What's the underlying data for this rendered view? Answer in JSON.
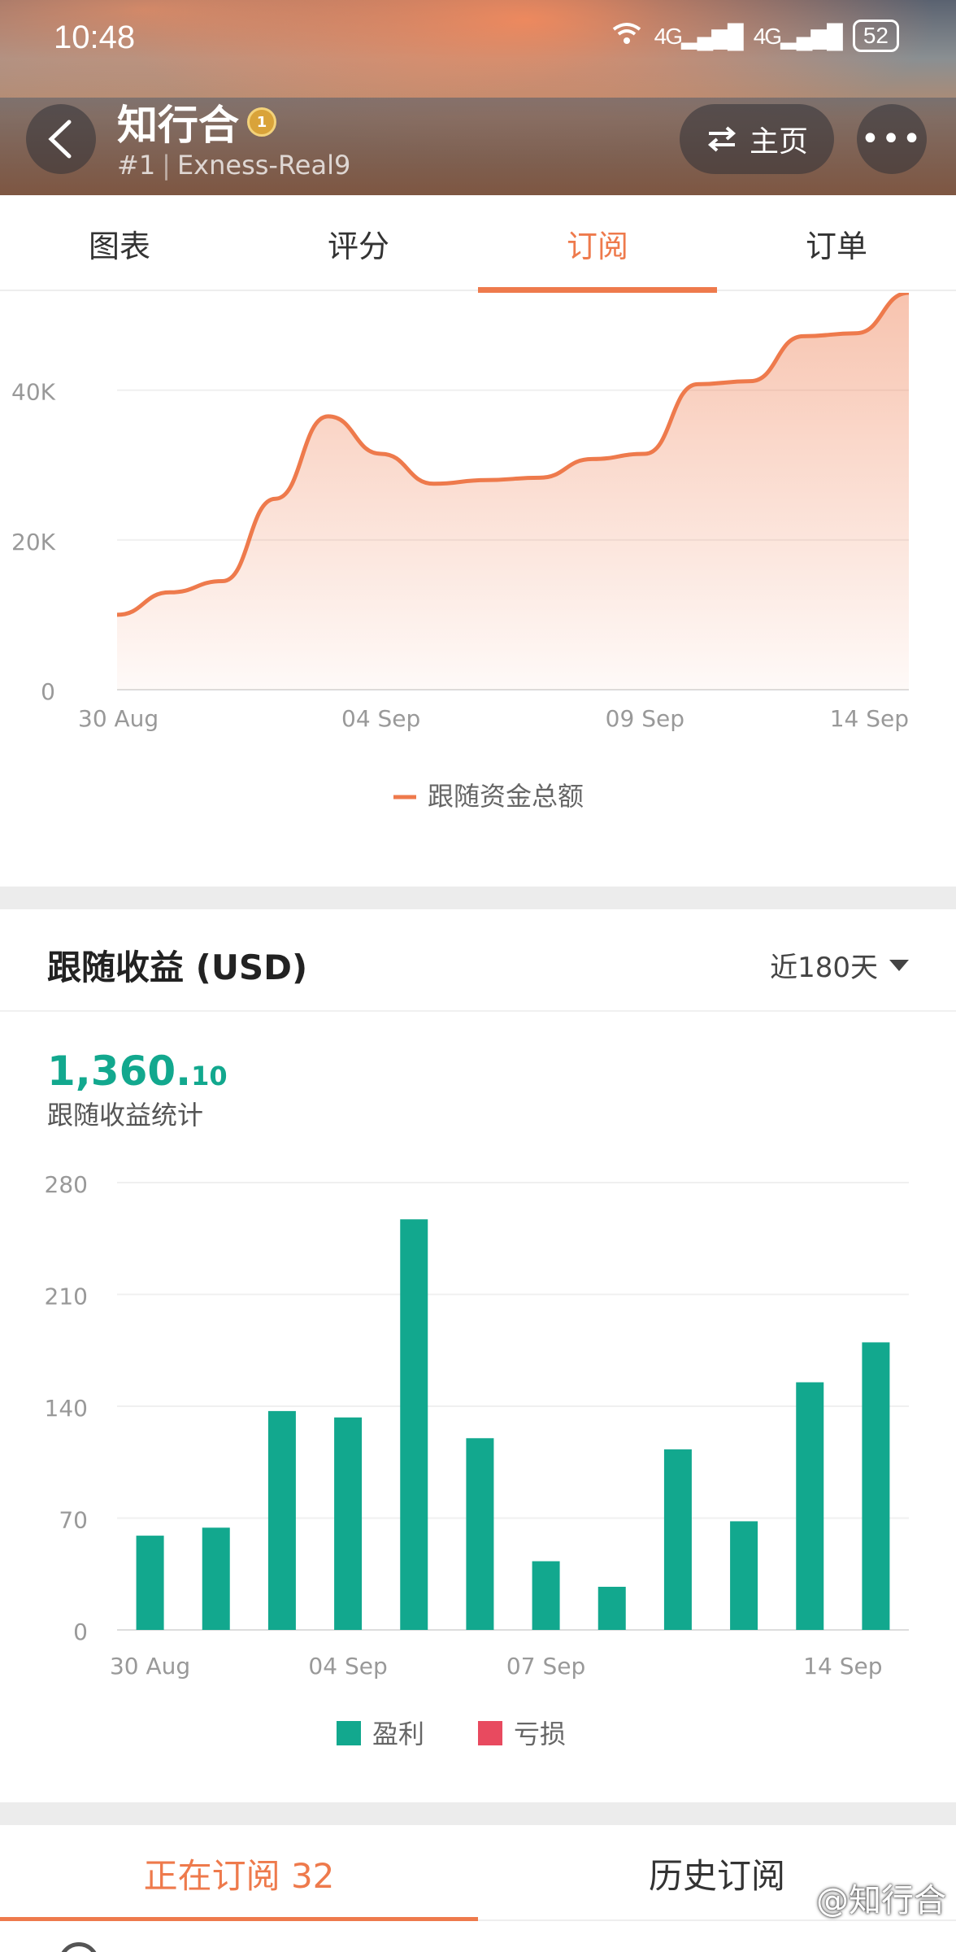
{
  "status_bar": {
    "time": "10:48",
    "signal1": "4G",
    "signal2": "4G",
    "battery": "52"
  },
  "header": {
    "trader_name": "知行合",
    "rank": "#1",
    "account": "Exness-Real9",
    "home_label": "主页",
    "more_label": "•••",
    "medal_icon": "medal-icon",
    "swap_icon": "swap-icon"
  },
  "tabs": [
    {
      "label": "图表",
      "active": false
    },
    {
      "label": "评分",
      "active": false
    },
    {
      "label": "订阅",
      "active": true
    },
    {
      "label": "订单",
      "active": false
    }
  ],
  "colors": {
    "accent": "#ee7a4c",
    "profit": "#12a88e",
    "loss": "#e84a5f"
  },
  "follow_funds_chart": {
    "legend": "跟随资金总额"
  },
  "earnings": {
    "title": "跟随收益 (USD)",
    "range": "近180天",
    "total_int": "1,360.",
    "total_dec": "10",
    "caption": "跟随收益统计",
    "legend_profit": "盈利",
    "legend_loss": "亏损"
  },
  "chart_data": [
    {
      "type": "area",
      "xlabel": "",
      "ylabel": "",
      "ylim": [
        0,
        53000
      ],
      "yticks": [
        "0",
        "20K",
        "40K"
      ],
      "ytick_values": [
        0,
        20000,
        40000
      ],
      "xticks": [
        "30 Aug",
        "04 Sep",
        "09 Sep",
        "14 Sep"
      ],
      "grid": true,
      "legend_placement": "bottom-center",
      "series": [
        {
          "name": "跟随资金总额",
          "color": "#ee7a4c",
          "x": [
            "30 Aug",
            "31 Aug",
            "01 Sep",
            "02 Sep",
            "03 Sep",
            "04 Sep",
            "05 Sep",
            "06 Sep",
            "07 Sep",
            "08 Sep",
            "09 Sep",
            "10 Sep",
            "11 Sep",
            "12 Sep",
            "13 Sep",
            "14 Sep"
          ],
          "values": [
            10000,
            13000,
            14500,
            25500,
            36500,
            31500,
            27500,
            28000,
            28300,
            30800,
            31500,
            40800,
            41200,
            47200,
            47600,
            53000
          ]
        }
      ]
    },
    {
      "type": "bar",
      "xlabel": "",
      "ylabel": "",
      "ylim": [
        0,
        280
      ],
      "yticks": [
        "0",
        "70",
        "140",
        "210",
        "280"
      ],
      "ytick_values": [
        0,
        70,
        140,
        210,
        280
      ],
      "xticks": [
        "30 Aug",
        "04 Sep",
        "07 Sep",
        "14 Sep"
      ],
      "xtick_positions": [
        0,
        3,
        6,
        10.5
      ],
      "grid": true,
      "legend_placement": "bottom-center",
      "categories": [
        "30 Aug",
        "31 Aug",
        "01 Sep",
        "02 Sep",
        "04 Sep",
        "05 Sep",
        "06 Sep",
        "07 Sep",
        "08 Sep",
        "11 Sep",
        "13 Sep",
        "14 Sep"
      ],
      "series": [
        {
          "name": "盈利",
          "color": "#12a88e",
          "values": [
            59,
            64,
            137,
            133,
            257,
            120,
            43,
            27,
            113,
            68,
            155,
            180
          ]
        },
        {
          "name": "亏损",
          "color": "#e84a5f",
          "values": [
            0,
            0,
            0,
            0,
            0,
            0,
            0,
            0,
            0,
            0,
            0,
            0
          ]
        }
      ]
    }
  ],
  "bottom_tabs": [
    {
      "label": "正在订阅 32",
      "active": true
    },
    {
      "label": "历史订阅",
      "active": false
    }
  ],
  "watermark": "@知行合"
}
